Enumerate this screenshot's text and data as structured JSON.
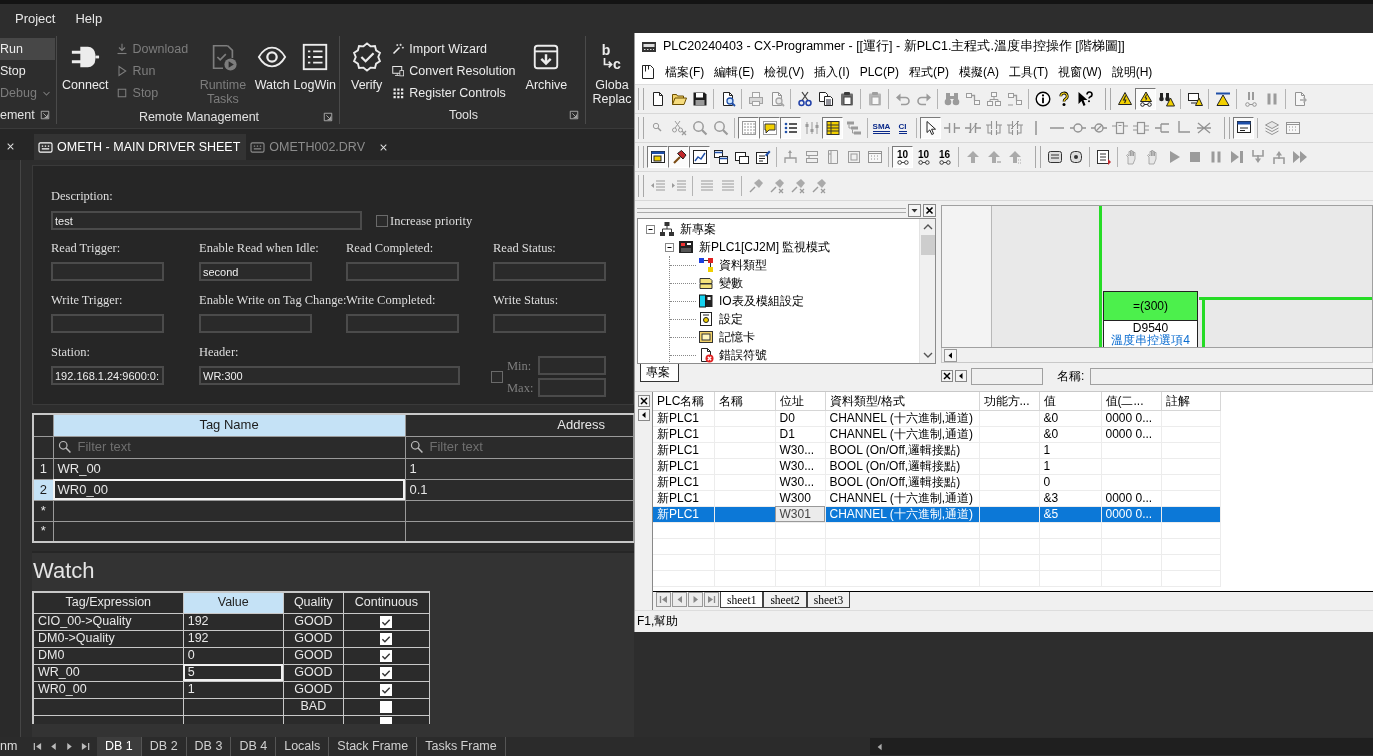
{
  "ide": {
    "menu": [
      "Project",
      "Help"
    ],
    "ribbon": [
      {
        "label": "ement",
        "items": [
          {
            "kind": "stack",
            "buttons": [
              {
                "label": "Run",
                "disabled": false,
                "highlighted": true,
                "dropdown": false
              },
              {
                "label": "Stop",
                "disabled": false,
                "highlighted": false,
                "dropdown": false
              },
              {
                "label": "Debug",
                "disabled": true,
                "highlighted": false,
                "dropdown": true
              }
            ]
          }
        ]
      },
      {
        "label": "Remote Management",
        "items": [
          {
            "kind": "large",
            "label": "Connect",
            "disabled": false
          },
          {
            "kind": "stack",
            "buttons": [
              {
                "label": "Download",
                "disabled": true,
                "highlighted": false,
                "dropdown": false
              },
              {
                "label": "Run",
                "disabled": true,
                "highlighted": false,
                "dropdown": false
              },
              {
                "label": "Stop",
                "disabled": true,
                "highlighted": false,
                "dropdown": false
              }
            ]
          },
          {
            "kind": "large",
            "label": "Runtime Tasks",
            "disabled": true
          },
          {
            "kind": "large",
            "label": "Watch",
            "disabled": false
          },
          {
            "kind": "large",
            "label": "LogWin",
            "disabled": false
          }
        ]
      },
      {
        "label": "Tools",
        "items": [
          {
            "kind": "large",
            "label": "Verify",
            "disabled": false
          },
          {
            "kind": "stack",
            "buttons": [
              {
                "label": "Import Wizard",
                "disabled": false,
                "highlighted": false,
                "dropdown": false
              },
              {
                "label": "Convert Resolution",
                "disabled": false,
                "highlighted": false,
                "dropdown": false
              },
              {
                "label": "Register Controls",
                "disabled": false,
                "highlighted": false,
                "dropdown": false
              }
            ]
          },
          {
            "kind": "large",
            "label": "Archive",
            "disabled": false
          }
        ]
      },
      {
        "items": [
          {
            "kind": "large",
            "label": "Globa Replac",
            "disabled": false,
            "icon_text": [
              "b",
              "c"
            ]
          }
        ]
      }
    ],
    "doc_tabs": [
      {
        "label": "OMETH - MAIN DRIVER SHEET",
        "selected": true,
        "closable": false
      },
      {
        "label": "OMETH002.DRV",
        "selected": false,
        "closable": true
      }
    ],
    "driver_form": {
      "description": {
        "label": "Description:",
        "value": "test"
      },
      "increase_priority": {
        "label": "Increase priority",
        "checked": false
      },
      "rows": [
        [
          {
            "label": "Read Trigger:"
          },
          {
            "label": "Enable Read when Idle:",
            "value": "second"
          },
          {
            "label": "Read Completed:"
          },
          {
            "label": "Read Status:"
          }
        ],
        [
          {
            "label": "Write Trigger:"
          },
          {
            "label": "Enable Write on Tag Change:"
          },
          {
            "label": "Write Completed:"
          },
          {
            "label": "Write Status:"
          }
        ],
        [
          {
            "label": "Station:",
            "value": "192.168.1.24:9600:0:"
          },
          {
            "label": "Header:",
            "value": "WR:300"
          }
        ]
      ],
      "range": {
        "checked": false,
        "disabled": true,
        "fields": [
          {
            "label": "Min:"
          },
          {
            "label": "Max:"
          }
        ]
      }
    },
    "tag_grid": {
      "columns": [
        {
          "label": "Tag Name",
          "highlighted": true,
          "filter_placeholder": "Filter text"
        },
        {
          "label": "Address",
          "highlighted": false,
          "filter_placeholder": "Filter text"
        }
      ],
      "rows": [
        {
          "header": "1",
          "cells": [
            "WR_00",
            "1"
          ],
          "selected": false
        },
        {
          "header": "2",
          "cells": [
            "WR0_00",
            "0.1"
          ],
          "selected": true
        },
        {
          "header": "*",
          "selected": false
        },
        {
          "header": "*",
          "selected": false
        }
      ]
    },
    "watch": {
      "title": "Watch",
      "columns": [
        {
          "label": "Tag/Expression",
          "highlighted": false
        },
        {
          "label": "Value",
          "highlighted": true
        },
        {
          "label": "Quality",
          "highlighted": false
        },
        {
          "label": "Continuous",
          "highlighted": false
        }
      ],
      "rows": [
        {
          "expression": "CIO_00->Quality",
          "value": "192",
          "quality": "GOOD",
          "continuous": true,
          "editing": false
        },
        {
          "expression": "DM0->Quality",
          "value": "192",
          "quality": "GOOD",
          "continuous": true,
          "editing": false
        },
        {
          "expression": "DM0",
          "value": "0",
          "quality": "GOOD",
          "continuous": true,
          "editing": false
        },
        {
          "expression": "WR_00",
          "value": "5",
          "quality": "GOOD",
          "continuous": true,
          "editing": true
        },
        {
          "expression": "WR0_00",
          "value": "1",
          "quality": "GOOD",
          "continuous": true,
          "editing": false
        },
        {
          "quality": "BAD",
          "continuous": false,
          "editing": false
        },
        {
          "continuous": false,
          "editing": false
        }
      ]
    },
    "bottom_bar": {
      "side_tab": "nm",
      "tabs": [
        {
          "label": "DB 1",
          "selected": true
        },
        {
          "label": "DB 2",
          "selected": false
        },
        {
          "label": "DB 3",
          "selected": false
        },
        {
          "label": "DB 4",
          "selected": false
        },
        {
          "label": "Locals",
          "selected": false
        },
        {
          "label": "Stack Frame",
          "selected": false
        },
        {
          "label": "Tasks Frame",
          "selected": false
        }
      ]
    }
  },
  "cx": {
    "title": "PLC20240403 - CX-Programmer - [[運行] - 新PLC1.主程式.溫度串控操作 [階梯圖]]",
    "menu": [
      "檔案(F)",
      "編輯(E)",
      "檢視(V)",
      "插入(I)",
      "PLC(P)",
      "程式(P)",
      "模擬(A)",
      "工具(T)",
      "視窗(W)",
      "說明(H)"
    ],
    "toolbar_rows": [
      [
        {
          "groups": [
            [
              {
                "disabled": false,
                "on": false
              },
              {
                "disabled": false,
                "on": false
              },
              {
                "disabled": false,
                "on": false
              }
            ],
            [
              {
                "disabled": false,
                "on": false
              }
            ],
            [
              {
                "disabled": true,
                "on": false
              },
              {
                "disabled": true,
                "on": false
              }
            ],
            [
              {
                "disabled": false,
                "on": false
              },
              {
                "disabled": false,
                "on": false
              },
              {
                "disabled": false,
                "on": false
              }
            ],
            [
              {
                "disabled": true,
                "on": false
              }
            ],
            [
              {
                "disabled": true,
                "on": false
              },
              {
                "disabled": true,
                "on": false
              }
            ],
            [
              {
                "disabled": true,
                "on": false
              },
              {
                "disabled": true,
                "on": false
              },
              {
                "disabled": true,
                "on": false
              },
              {
                "disabled": true,
                "on": false
              }
            ],
            [
              {
                "disabled": false,
                "on": false
              },
              {
                "disabled": false,
                "on": false
              },
              {
                "disabled": false,
                "on": false
              }
            ]
          ]
        },
        {
          "groups": [
            [
              {
                "disabled": false,
                "on": false
              },
              {
                "disabled": false,
                "on": true
              },
              {
                "disabled": false,
                "on": false
              }
            ],
            [
              {
                "disabled": false,
                "on": false
              }
            ],
            [
              {
                "disabled": false,
                "on": false
              }
            ],
            [
              {
                "disabled": true,
                "on": false
              },
              {
                "disabled": true,
                "on": false
              }
            ],
            [
              {
                "disabled": true,
                "on": false
              }
            ]
          ]
        }
      ],
      [
        {
          "groups": [
            [
              {
                "disabled": true,
                "on": false
              },
              {
                "disabled": true,
                "on": false
              },
              {
                "disabled": true,
                "on": false
              },
              {
                "disabled": true,
                "on": false
              }
            ],
            [
              {
                "disabled": false,
                "on": true
              },
              {
                "disabled": false,
                "on": true
              },
              {
                "disabled": false,
                "on": true
              },
              {
                "disabled": true,
                "on": false
              },
              {
                "disabled": false,
                "on": true
              },
              {
                "disabled": true,
                "on": false
              }
            ],
            [
              {
                "label": "SMA",
                "disabled": false,
                "on": false
              },
              {
                "label": "CI",
                "disabled": false,
                "on": false
              }
            ],
            [
              {
                "disabled": false,
                "on": true
              },
              {
                "disabled": true,
                "on": false
              },
              {
                "disabled": true,
                "on": false
              },
              {
                "disabled": true,
                "on": false
              },
              {
                "disabled": true,
                "on": false
              },
              {
                "disabled": true,
                "on": false
              },
              {
                "disabled": true,
                "on": false
              },
              {
                "disabled": true,
                "on": false
              },
              {
                "disabled": true,
                "on": false
              },
              {
                "disabled": true,
                "on": false
              },
              {
                "disabled": true,
                "on": false
              },
              {
                "disabled": true,
                "on": false
              },
              {
                "disabled": true,
                "on": false
              },
              {
                "disabled": true,
                "on": false
              }
            ]
          ]
        },
        {
          "groups": [
            [
              {
                "disabled": false,
                "on": true
              }
            ],
            [
              {
                "disabled": true,
                "on": false
              },
              {
                "disabled": true,
                "on": false
              }
            ]
          ]
        }
      ],
      [
        {
          "groups": [
            [
              {
                "disabled": false,
                "on": true
              },
              {
                "disabled": false,
                "on": true
              },
              {
                "disabled": false,
                "on": true
              },
              {
                "disabled": false,
                "on": false
              },
              {
                "disabled": false,
                "on": false
              },
              {
                "disabled": false,
                "on": false
              }
            ],
            [
              {
                "disabled": true,
                "on": false
              },
              {
                "disabled": true,
                "on": false
              },
              {
                "disabled": true,
                "on": false
              },
              {
                "disabled": true,
                "on": false
              },
              {
                "disabled": true,
                "on": false
              }
            ],
            [
              {
                "label": "10",
                "disabled": false,
                "on": true
              },
              {
                "label": "10",
                "disabled": false,
                "on": false
              },
              {
                "label": "16",
                "disabled": false,
                "on": false
              }
            ],
            [
              {
                "disabled": true,
                "on": false
              },
              {
                "disabled": true,
                "on": false
              },
              {
                "disabled": true,
                "on": false
              }
            ]
          ]
        },
        {
          "groups": [
            [
              {
                "disabled": false,
                "on": false
              },
              {
                "disabled": false,
                "on": false
              }
            ],
            [
              {
                "disabled": false,
                "on": false
              }
            ],
            [
              {
                "disabled": true,
                "on": false
              },
              {
                "disabled": true,
                "on": false
              },
              {
                "disabled": true,
                "on": false
              },
              {
                "disabled": true,
                "on": false
              },
              {
                "disabled": true,
                "on": false
              },
              {
                "disabled": true,
                "on": false
              },
              {
                "disabled": true,
                "on": false
              },
              {
                "disabled": true,
                "on": false
              },
              {
                "disabled": true,
                "on": false
              }
            ]
          ]
        }
      ],
      [
        {
          "groups": [
            [
              {
                "disabled": true,
                "on": false
              },
              {
                "disabled": true,
                "on": false
              }
            ],
            [
              {
                "disabled": true,
                "on": false
              },
              {
                "disabled": true,
                "on": false
              }
            ],
            [
              {
                "disabled": true,
                "on": false
              },
              {
                "disabled": true,
                "on": false
              },
              {
                "disabled": true,
                "on": false
              },
              {
                "disabled": true,
                "on": false
              }
            ]
          ]
        }
      ]
    ],
    "project": {
      "tab": "專案",
      "tree": [
        {
          "label": "新專案",
          "expanded": true,
          "children": [
            {
              "label": "新PLC1[CJ2M] 監視模式",
              "expanded": true,
              "children": [
                {
                  "label": "資料類型"
                },
                {
                  "label": "變數"
                },
                {
                  "label": "IO表及模組設定"
                },
                {
                  "label": "設定"
                },
                {
                  "label": "記憶卡"
                },
                {
                  "label": "錯誤符號"
                }
              ]
            }
          ]
        }
      ]
    },
    "ladder": {
      "instruction": "=(300)",
      "operand": "D9540",
      "comment": "溫度串控選項4"
    },
    "name_field": {
      "label": "名稱:"
    },
    "watch": {
      "columns": [
        "PLC名稱",
        "名稱",
        "位址",
        "資料類型/格式",
        "功能方...",
        "值",
        "值(二...",
        "註解"
      ],
      "rows": [
        {
          "plc": "新PLC1",
          "address": "D0",
          "data_type": "CHANNEL (十六進制,通道)",
          "value": "&0",
          "value_2": "0000 0...",
          "selected": false,
          "address_focused": false
        },
        {
          "plc": "新PLC1",
          "address": "D1",
          "data_type": "CHANNEL (十六進制,通道)",
          "value": "&0",
          "value_2": "0000 0...",
          "selected": false,
          "address_focused": false
        },
        {
          "plc": "新PLC1",
          "address": "W30...",
          "data_type": "BOOL (On/Off,邏輯接點)",
          "value": "1",
          "selected": false,
          "address_focused": false
        },
        {
          "plc": "新PLC1",
          "address": "W30...",
          "data_type": "BOOL (On/Off,邏輯接點)",
          "value": "1",
          "selected": false,
          "address_focused": false
        },
        {
          "plc": "新PLC1",
          "address": "W30...",
          "data_type": "BOOL (On/Off,邏輯接點)",
          "value": "0",
          "selected": false,
          "address_focused": false
        },
        {
          "plc": "新PLC1",
          "address": "W300",
          "data_type": "CHANNEL (十六進制,通道)",
          "value": "&3",
          "value_2": "0000 0...",
          "selected": false,
          "address_focused": false
        },
        {
          "plc": "新PLC1",
          "address": "W301",
          "data_type": "CHANNEL (十六進制,通道)",
          "value": "&5",
          "value_2": "0000 0...",
          "selected": true,
          "address_focused": true
        }
      ]
    },
    "sheets": [
      {
        "label": "sheet1",
        "selected": true
      },
      {
        "label": "sheet2",
        "selected": false
      },
      {
        "label": "sheet3",
        "selected": false
      }
    ],
    "status": "F1,幫助"
  }
}
